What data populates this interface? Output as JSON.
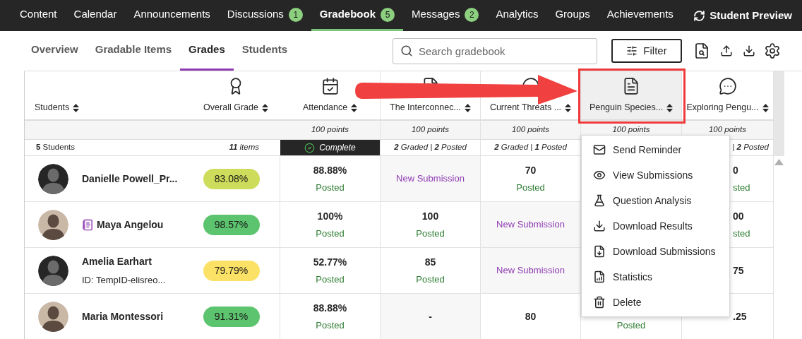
{
  "nav": {
    "items": [
      {
        "label": "Content",
        "selected": false
      },
      {
        "label": "Calendar",
        "selected": false
      },
      {
        "label": "Announcements",
        "selected": false
      },
      {
        "label": "Discussions",
        "badge": "1",
        "selected": false
      },
      {
        "label": "Gradebook",
        "badge": "5",
        "selected": true
      },
      {
        "label": "Messages",
        "badge": "2",
        "selected": false
      },
      {
        "label": "Analytics",
        "selected": false
      },
      {
        "label": "Groups",
        "selected": false
      },
      {
        "label": "Achievements",
        "selected": false
      }
    ],
    "preview": "Student Preview"
  },
  "subtabs": [
    {
      "label": "Overview",
      "selected": false
    },
    {
      "label": "Gradable Items",
      "selected": false
    },
    {
      "label": "Grades",
      "selected": true
    },
    {
      "label": "Students",
      "selected": false
    }
  ],
  "search": {
    "placeholder": "Search gradebook"
  },
  "filter": "Filter",
  "table": {
    "columns": [
      {
        "label": "Students",
        "summary": "**5** Students",
        "highlighted": false
      },
      {
        "label": "Overall Grade",
        "summary": "**11** items",
        "highlighted": false
      },
      {
        "label": "Attendance",
        "points": "100 points",
        "summary": "Complete",
        "complete": true,
        "highlighted": false
      },
      {
        "label": "The Interconnec...",
        "points": "100 points",
        "summary": "**2** Graded | **2** Posted",
        "complete": false,
        "highlighted": false
      },
      {
        "label": "Current Threats ...",
        "points": "100 points",
        "summary": "**2** Graded | **1** Posted",
        "complete": false,
        "highlighted": false
      },
      {
        "label": "Penguin Species...",
        "points": "100 points",
        "highlighted": true
      },
      {
        "label": "Exploring Pengu...",
        "points": "100 points",
        "summary": "| **2** Posted",
        "complete": false,
        "highlighted": false
      }
    ],
    "rows": [
      {
        "cells": [
          {
            "kind": "student",
            "name": "Danielle Powell_Pr...",
            "photo": false,
            "note": false
          },
          {
            "kind": "overall",
            "grade": "83.08%",
            "color": "#cddc5a"
          },
          {
            "kind": "grade",
            "value": "88.88%",
            "status": "Posted"
          },
          {
            "kind": "submission",
            "text": "New Submission"
          },
          {
            "kind": "grade",
            "value": "70",
            "status": "Posted"
          },
          "",
          {
            "kind": "grade",
            "value": "0",
            "status": "sted"
          }
        ]
      },
      {
        "cells": [
          {
            "kind": "student",
            "name": "Maya Angelou",
            "photo": true,
            "note": true
          },
          {
            "kind": "overall",
            "grade": "98.57%",
            "color": "#5cc46e"
          },
          {
            "kind": "grade",
            "value": "100%",
            "status": "Posted"
          },
          {
            "kind": "grade",
            "value": "100",
            "status": "Posted"
          },
          {
            "kind": "submission",
            "text": "New Submission"
          },
          "",
          {
            "kind": "grade",
            "value": "00",
            "status": "sted"
          }
        ]
      },
      {
        "cells": [
          {
            "kind": "student",
            "name": "Amelia Earhart",
            "subtitle": "ID: TempID-elisreo...",
            "photo": false,
            "note": false
          },
          {
            "kind": "overall",
            "grade": "79.79%",
            "color": "#fbe266"
          },
          {
            "kind": "grade",
            "value": "52.77%",
            "status": "Posted"
          },
          {
            "kind": "grade",
            "value": "85",
            "status": "Posted"
          },
          {
            "kind": "submission",
            "text": "New Submission"
          },
          "",
          {
            "kind": "value",
            "value": "75"
          }
        ]
      },
      {
        "cells": [
          {
            "kind": "student",
            "name": "Maria Montessori",
            "photo": true,
            "note": false
          },
          {
            "kind": "overall",
            "grade": "91.31%",
            "color": "#5cc46e"
          },
          {
            "kind": "grade",
            "value": "88.88%",
            "status": "Posted"
          },
          {
            "kind": "empty",
            "text": "-"
          },
          {
            "kind": "value",
            "value": "80"
          },
          {
            "kind": "grade",
            "status": "Posted"
          },
          {
            "kind": "value",
            "value": ".25"
          }
        ]
      }
    ]
  },
  "menu": [
    "Send Reminder",
    "View Submissions",
    "Question Analysis",
    "Download Results",
    "Download Submissions",
    "Statistics",
    "Delete"
  ]
}
